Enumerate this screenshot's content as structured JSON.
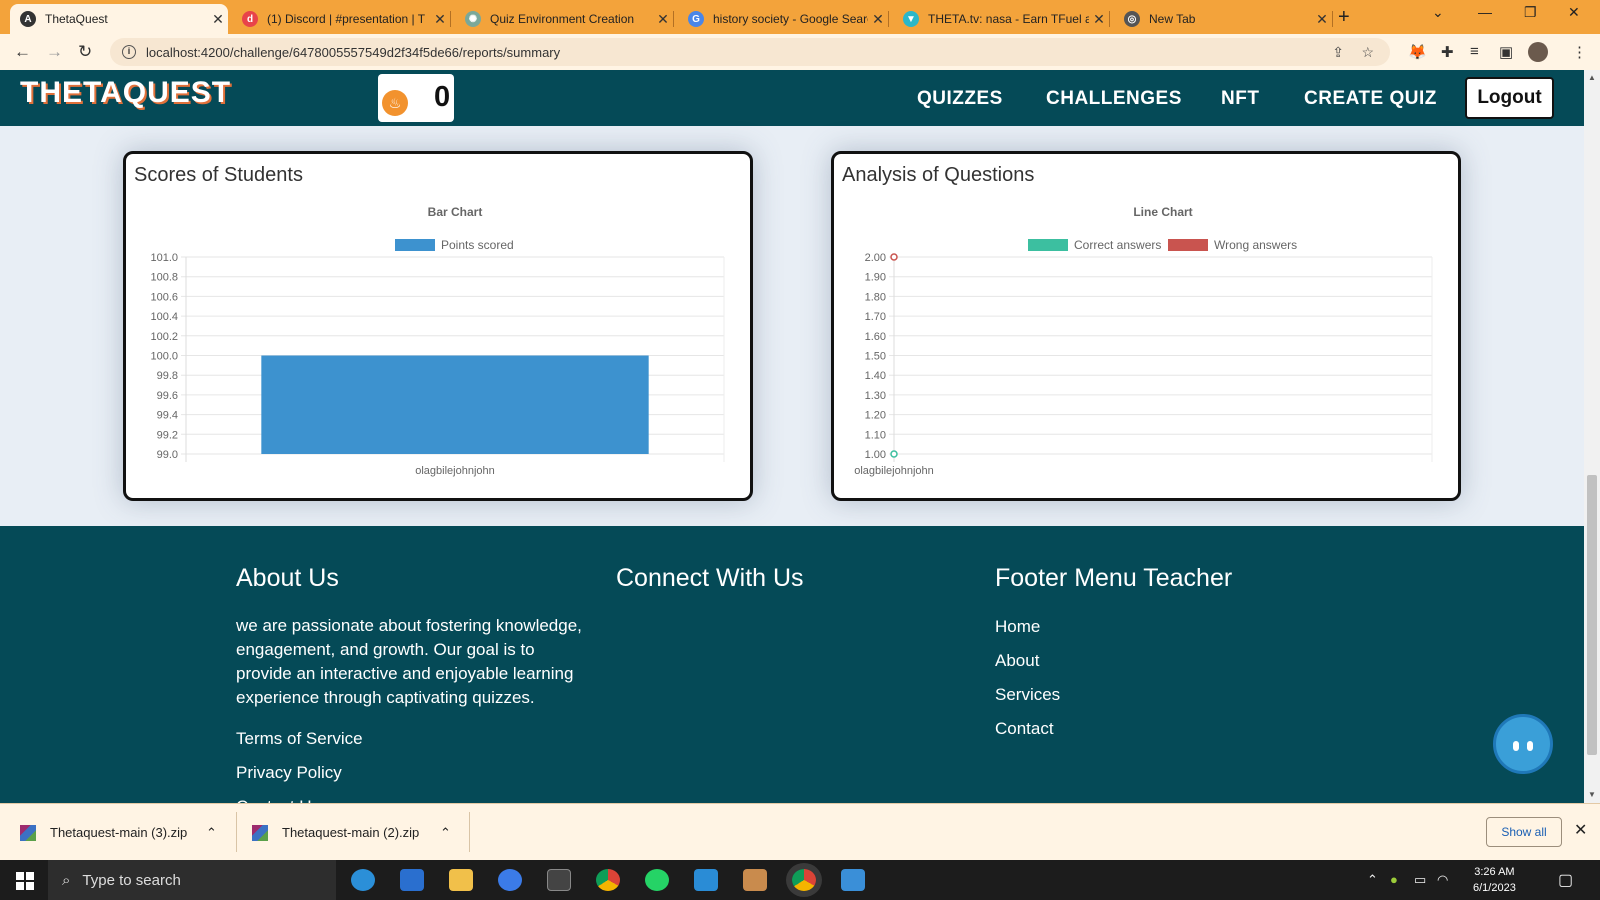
{
  "browser": {
    "tabs": [
      {
        "title": "ThetaQuest",
        "icon": "angular-icon",
        "color": "#333333",
        "glyph": "A"
      },
      {
        "title": "(1) Discord | #presentation | T",
        "icon": "discord-icon",
        "color": "#e8434a",
        "glyph": "d"
      },
      {
        "title": "Quiz Environment Creation",
        "icon": "chatgpt-icon",
        "color": "#7aa89a",
        "glyph": "✺"
      },
      {
        "title": "history society - Google Searc",
        "icon": "google-icon",
        "color": "#4a86e8",
        "glyph": "G"
      },
      {
        "title": "THETA.tv: nasa - Earn TFuel a",
        "icon": "theta-icon",
        "color": "#2bb7c9",
        "glyph": "▼"
      },
      {
        "title": "New Tab",
        "icon": "chrome-icon",
        "color": "#555555",
        "glyph": "◎"
      }
    ],
    "url": "localhost:4200/challenge/6478005557549d2f34f5de66/reports/summary"
  },
  "header": {
    "brand": "THETAQUEST",
    "coin_balance": "0",
    "nav": [
      "QUIZZES",
      "CHALLENGES",
      "NFT",
      "CREATE QUIZ"
    ],
    "logout_label": "Logout"
  },
  "cards": {
    "scores": {
      "title": "Scores of Students"
    },
    "analysis": {
      "title": "Analysis of Questions"
    }
  },
  "chart_data": [
    {
      "type": "bar",
      "title": "Bar Chart",
      "categories": [
        "olagbilejohnjohn"
      ],
      "series": [
        {
          "name": "Points scored",
          "values": [
            100
          ],
          "color": "#3d92cf"
        }
      ],
      "ylim": [
        99.0,
        101.0
      ],
      "yticks": [
        "101.0",
        "100.8",
        "100.6",
        "100.4",
        "100.2",
        "100.0",
        "99.8",
        "99.6",
        "99.4",
        "99.2",
        "99.0"
      ],
      "legend": "top",
      "grid": true
    },
    {
      "type": "line",
      "title": "Line Chart",
      "categories": [
        "olagbilejohnjohn"
      ],
      "series": [
        {
          "name": "Correct answers",
          "values": [
            1
          ],
          "color": "#3cbfa0"
        },
        {
          "name": "Wrong answers",
          "values": [
            2
          ],
          "color": "#c9544f"
        }
      ],
      "ylim": [
        1.0,
        2.0
      ],
      "yticks": [
        "2.00",
        "1.90",
        "1.80",
        "1.70",
        "1.60",
        "1.50",
        "1.40",
        "1.30",
        "1.20",
        "1.10",
        "1.00"
      ],
      "legend": "top",
      "grid": true
    }
  ],
  "footer": {
    "about_title": "About Us",
    "about_text": "we are passionate about fostering knowledge, engagement, and growth. Our goal is to provide an interactive and enjoyable learning experience through captivating quizzes.",
    "about_links": [
      "Terms of Service",
      "Privacy Policy",
      "Contact Us"
    ],
    "connect_title": "Connect With Us",
    "menu_title": "Footer Menu Teacher",
    "menu_links": [
      "Home",
      "About",
      "Services",
      "Contact"
    ]
  },
  "downloads": {
    "items": [
      "Thetaquest-main (3).zip",
      "Thetaquest-main (2).zip"
    ],
    "show_all": "Show all"
  },
  "taskbar": {
    "search_placeholder": "Type to search",
    "time": "3:26 AM",
    "date": "6/1/2023"
  }
}
